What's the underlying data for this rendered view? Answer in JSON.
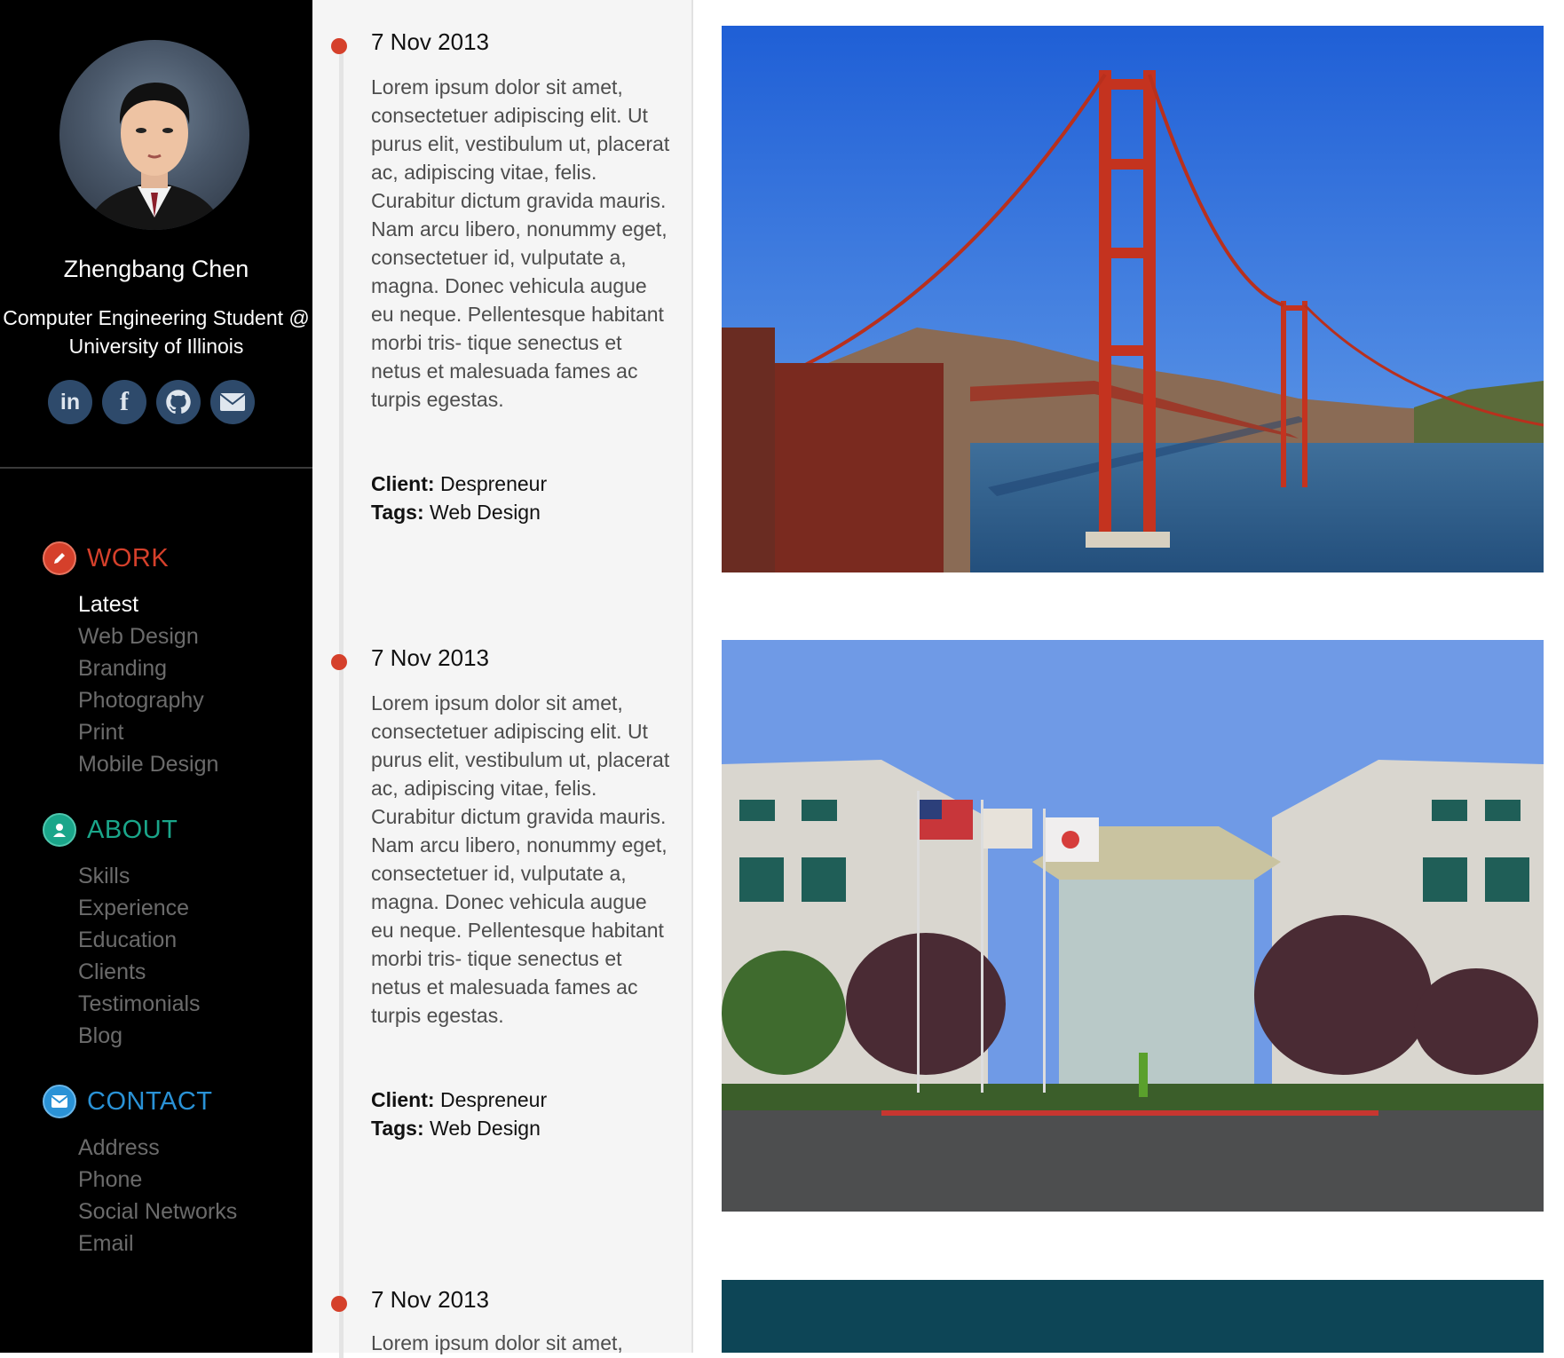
{
  "profile": {
    "name": "Zhengbang Chen",
    "title_line1": "Computer Engineering Student @",
    "title_line2": "University of Illinois"
  },
  "socials": [
    {
      "icon": "linkedin-icon",
      "glyph": "in"
    },
    {
      "icon": "facebook-icon",
      "glyph": "f"
    },
    {
      "icon": "github-icon",
      "glyph": ""
    },
    {
      "icon": "mail-icon",
      "glyph": ""
    }
  ],
  "nav": {
    "work": {
      "label": "WORK",
      "color": "#d5402b",
      "items": [
        "Latest",
        "Web Design",
        "Branding",
        "Photography",
        "Print",
        "Mobile Design"
      ]
    },
    "about": {
      "label": "ABOUT",
      "color": "#1aa68a",
      "items": [
        "Skills",
        "Experience",
        "Education",
        "Clients",
        "Testimonials",
        "Blog"
      ]
    },
    "contact": {
      "label": "CONTACT",
      "color": "#2a92d6",
      "items": [
        "Address",
        "Phone",
        "Social Networks",
        "Email"
      ]
    }
  },
  "entries": [
    {
      "date": "7 Nov 2013",
      "body": "Lorem ipsum dolor sit amet, consectetuer adipiscing elit. Ut purus elit, vestibulum ut, placerat ac, adipiscing vitae, felis. Curabitur dictum gravida mauris. Nam arcu libero, nonummy eget, consectetuer id, vulputate a, magna. Donec vehicula augue eu neque. Pellentesque habitant morbi tris- tique senectus et netus et malesuada fames ac turpis egestas.",
      "client_label": "Client:",
      "client": "Despreneur",
      "tags_label": "Tags:",
      "tags": "Web Design"
    },
    {
      "date": "7 Nov 2013",
      "body": "Lorem ipsum dolor sit amet, consectetuer adipiscing elit. Ut purus elit, vestibulum ut, placerat ac, adipiscing vitae, felis. Curabitur dictum gravida mauris. Nam arcu libero, nonummy eget, consectetuer id, vulputate a, magna. Donec vehicula augue eu neque. Pellentesque habitant morbi tris- tique senectus et netus et malesuada fames ac turpis egestas.",
      "client_label": "Client:",
      "client": "Despreneur",
      "tags_label": "Tags:",
      "tags": "Web Design"
    },
    {
      "date": "7 Nov 2013",
      "body": "Lorem ipsum dolor sit amet,"
    }
  ]
}
